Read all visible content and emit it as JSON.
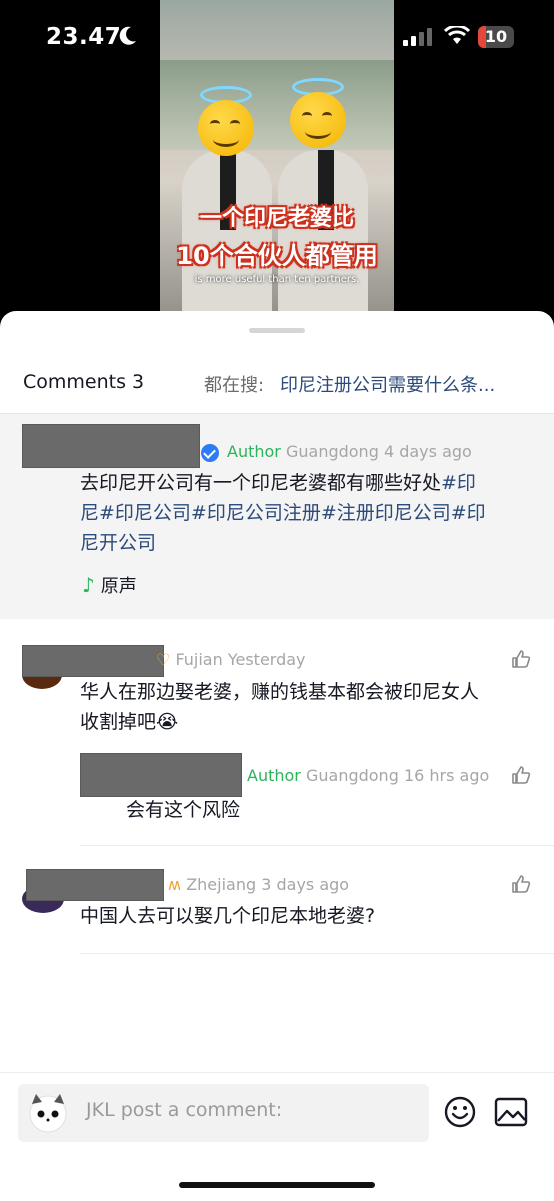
{
  "status_bar": {
    "time": "23.47",
    "battery_level": "10",
    "battery_color": "#e5473c"
  },
  "video": {
    "caption_line1": "一个印尼老婆比",
    "caption_line2": "10个合伙人都管用",
    "subtitle": "is more useful than ten partners."
  },
  "header": {
    "comments_label": "Comments 3",
    "search_prefix": "都在搜:",
    "search_query": "印尼注册公司需要什么条..."
  },
  "comments": [
    {
      "is_author": true,
      "author_tag": "Author",
      "location": "Guangdong",
      "time": "4 days ago",
      "text_line1_a": "去印尼开公司有一个印尼老婆都有哪些好处",
      "text_line1_b": "#印",
      "text_line2": "尼#印尼公司#印尼公司注册#注册印尼公司#印",
      "text_line3": "尼开公司",
      "sound_label": "原声"
    },
    {
      "location": "Fujian",
      "time": "Yesterday",
      "text_line1": "华人在那边娶老婆，赚的钱基本都会被印尼女人",
      "text_line2": "收割掉吧😭",
      "reply": {
        "author_tag": "Author",
        "location": "Guangdong",
        "time": "16 hrs ago",
        "text": "会有这个风险"
      }
    },
    {
      "location": "Zhejiang",
      "time": "3 days ago",
      "text": "中国人去可以娶几个印尼本地老婆?"
    }
  ],
  "input": {
    "placeholder": "JKL post a comment:"
  },
  "colors": {
    "author_green": "#2bb55a",
    "verified_blue": "#2d7cf6",
    "hashtag": "#2c4a7a"
  }
}
